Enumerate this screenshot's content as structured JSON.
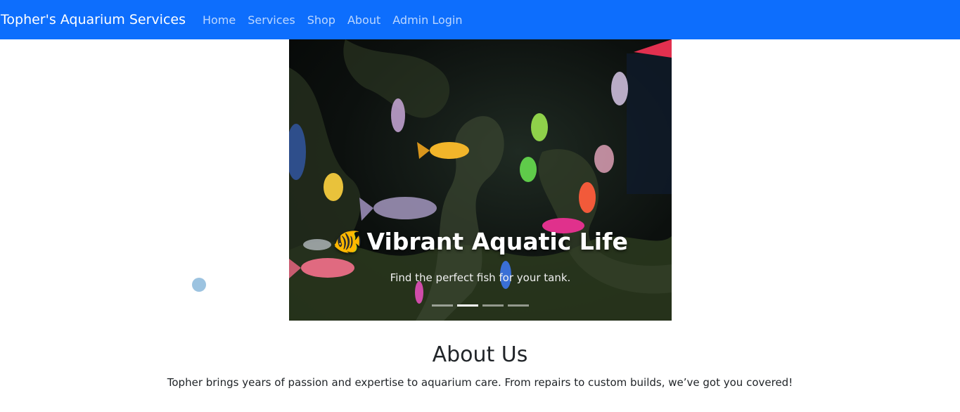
{
  "navbar": {
    "brand": "Topher's Aquarium Services",
    "links": [
      "Home",
      "Services",
      "Shop",
      "About",
      "Admin Login"
    ],
    "background": "#0d6efd"
  },
  "carousel": {
    "slide_icon": "fish-emoji",
    "title_emoji": "🐠",
    "title": "Vibrant Aquatic Life",
    "subtitle": "Find the perfect fish for your tank.",
    "indicator_count": 4,
    "active_index": 1
  },
  "about": {
    "title": "About Us",
    "text": "Topher brings years of passion and expertise to aquarium care. From repairs to custom builds, we’ve got you covered!"
  }
}
